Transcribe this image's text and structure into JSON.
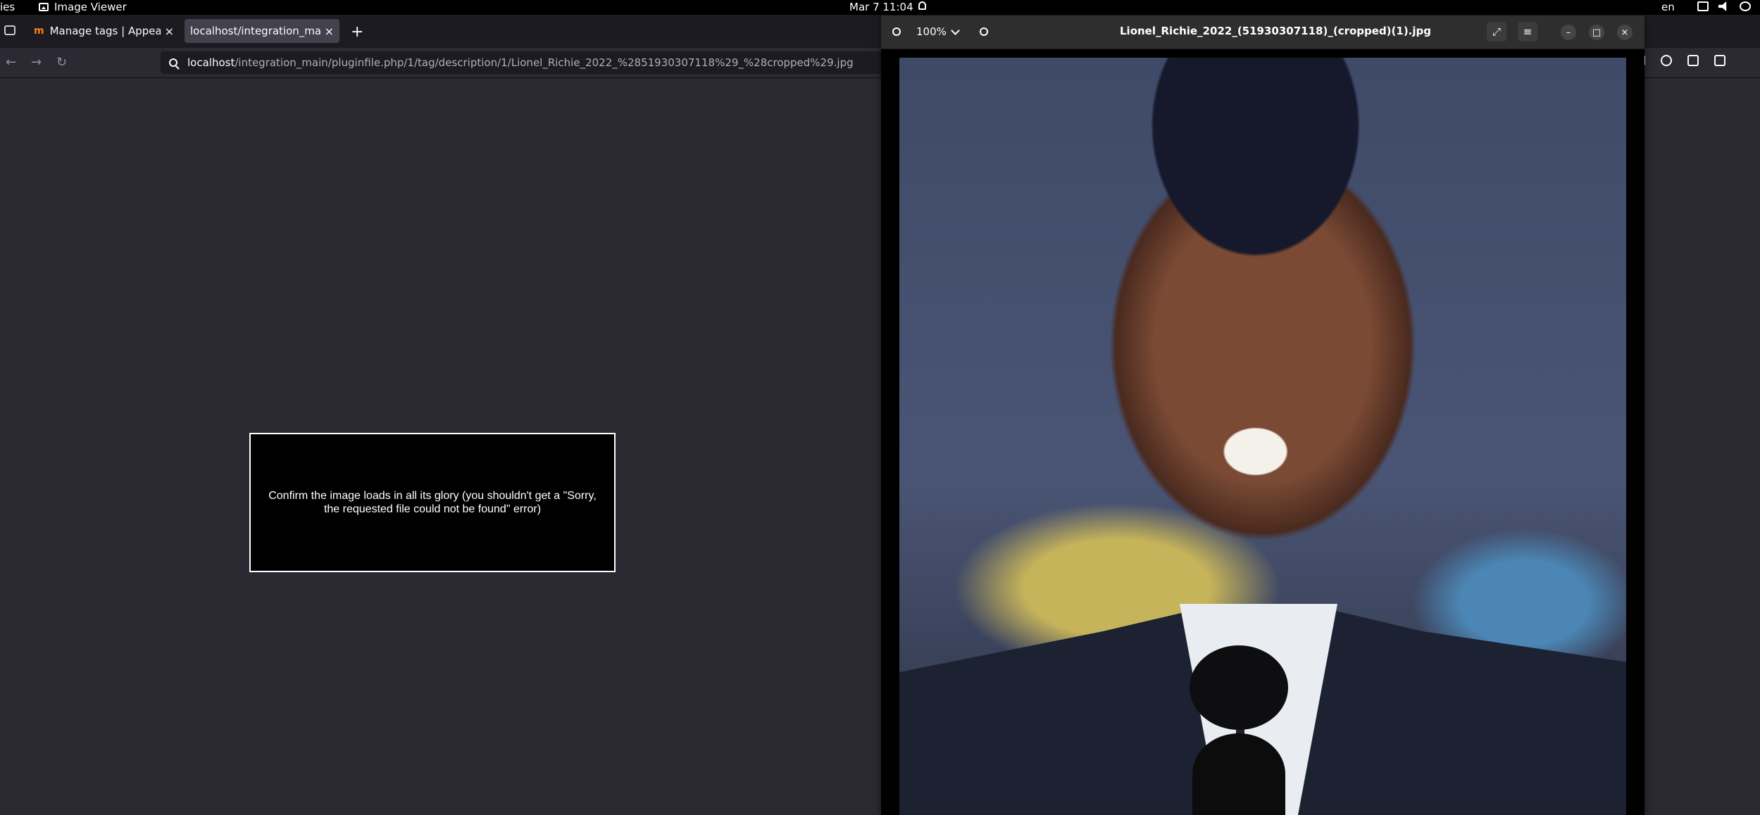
{
  "topbar": {
    "activities": "ies",
    "app_name": "Image Viewer",
    "clock": "Mar 7  11:04",
    "language": "en"
  },
  "browser": {
    "tabs": [
      {
        "label": "Manage tags | Appearance",
        "favicon": "m"
      },
      {
        "label": "localhost/integration_main/"
      }
    ],
    "url_host": "localhost",
    "url_path": "/integration_main/pluginfile.php/1/tag/description/1/Lionel_Richie_2022_%2851930307118%29_%28cropped%29.jpg",
    "instruction": "Confirm the image loads in all its glory (you shouldn't get a \"Sorry, the requested file could not be found\" error)"
  },
  "viewer": {
    "title": "Lionel_Richie_2022_(51930307118)_(cropped)(1).jpg",
    "zoom": "100%"
  }
}
